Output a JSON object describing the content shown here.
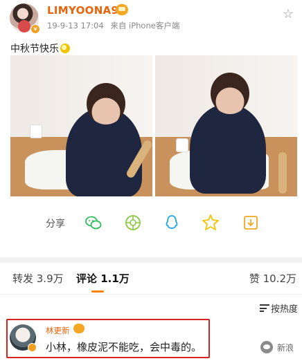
{
  "post": {
    "username": "LIMYOONA90",
    "time": "19-9-13 17:04",
    "source": "来自 iPhone客户端",
    "text": "中秋节快乐"
  },
  "share": {
    "label": "分享",
    "icons": [
      "wechat-icon",
      "moments-icon",
      "qq-icon",
      "qzone-icon",
      "save-icon"
    ]
  },
  "tabs": {
    "repost": "转发 3.9万",
    "comments": "评论 1.1万",
    "likes": "赞 10.2万"
  },
  "sort": {
    "label": "按热度"
  },
  "comment": {
    "name": "林更新",
    "text": "小林，橡皮泥不能吃，会中毒的。"
  },
  "watermark": {
    "text": "新浪"
  },
  "colors": {
    "accent": "#ff8200",
    "username": "#e8630a",
    "highlight_border": "#d8231f",
    "wechat": "#2fbd5a",
    "qq": "#1aa4e0",
    "qzone": "#f5c400"
  }
}
